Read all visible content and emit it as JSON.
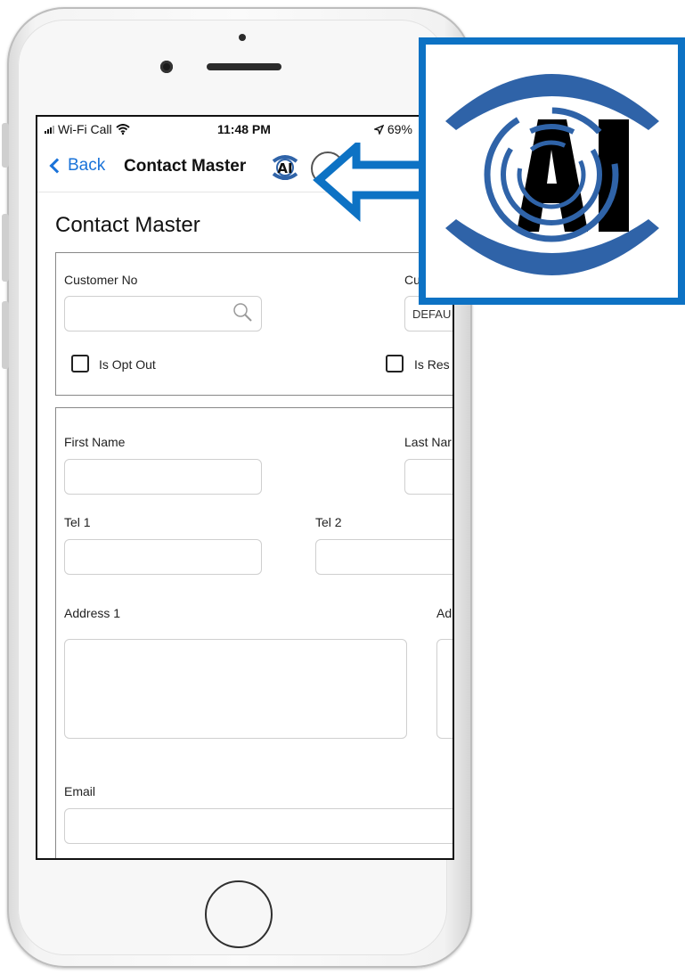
{
  "status_bar": {
    "carrier": "Wi-Fi Call",
    "time": "11:48 PM",
    "battery": "69%"
  },
  "nav": {
    "back_label": "Back",
    "title": "Contact Master"
  },
  "page": {
    "title": "Contact Master"
  },
  "form": {
    "customer_no_label": "Customer No",
    "customer_no_value": "",
    "customer_type_label_partial": "Cu",
    "customer_type_value_partial": "DEFAU",
    "is_opt_out_label": "Is Opt Out",
    "is_opt_out_checked": false,
    "is_res_label_partial": "Is Res",
    "is_res_checked": false,
    "first_name_label": "First Name",
    "first_name_value": "",
    "last_name_label_partial": "Last Nar",
    "tel1_label": "Tel 1",
    "tel2_label": "Tel 2",
    "address1_label": "Address 1",
    "address2_label_partial": "Ad",
    "email_label": "Email"
  },
  "callout": {
    "logo_text": "AI",
    "accent": "#0d72c4",
    "logo_blue": "#2f63a8"
  },
  "colors": {
    "ios_blue": "#1a73d9"
  }
}
